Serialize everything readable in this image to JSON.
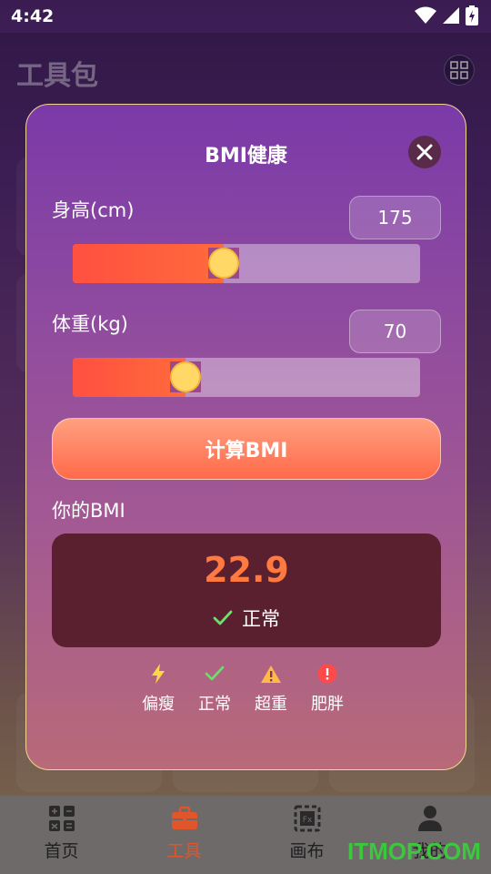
{
  "status_bar": {
    "time": "4:42"
  },
  "background": {
    "title": "工具包"
  },
  "modal": {
    "title": "BMI健康",
    "height": {
      "label": "身高(cm)",
      "value": "175",
      "slider_fraction": 0.39
    },
    "weight": {
      "label": "体重(kg)",
      "value": "70",
      "slider_fraction": 0.28
    },
    "calculate_label": "计算BMI",
    "result_label": "你的BMI",
    "result": {
      "value": "22.9",
      "status": "正常"
    },
    "legend": [
      {
        "label": "偏瘦",
        "icon": "lightning-icon",
        "color": "#ffd84a"
      },
      {
        "label": "正常",
        "icon": "check-icon",
        "color": "#6ee06e"
      },
      {
        "label": "超重",
        "icon": "warning-icon",
        "color": "#ffb84a"
      },
      {
        "label": "肥胖",
        "icon": "error-icon",
        "color": "#ff4a4a"
      }
    ]
  },
  "bottom_nav": [
    {
      "label": "首页",
      "icon": "calculator-icon"
    },
    {
      "label": "工具",
      "icon": "toolbox-icon",
      "active": true
    },
    {
      "label": "画布",
      "icon": "canvas-icon"
    },
    {
      "label": "我的",
      "icon": "person-icon"
    }
  ],
  "watermark": "ITMOP.COM",
  "colors": {
    "accent": "#ff6a3c",
    "result_value": "#ff7a40",
    "active_nav": "#e0552a"
  }
}
